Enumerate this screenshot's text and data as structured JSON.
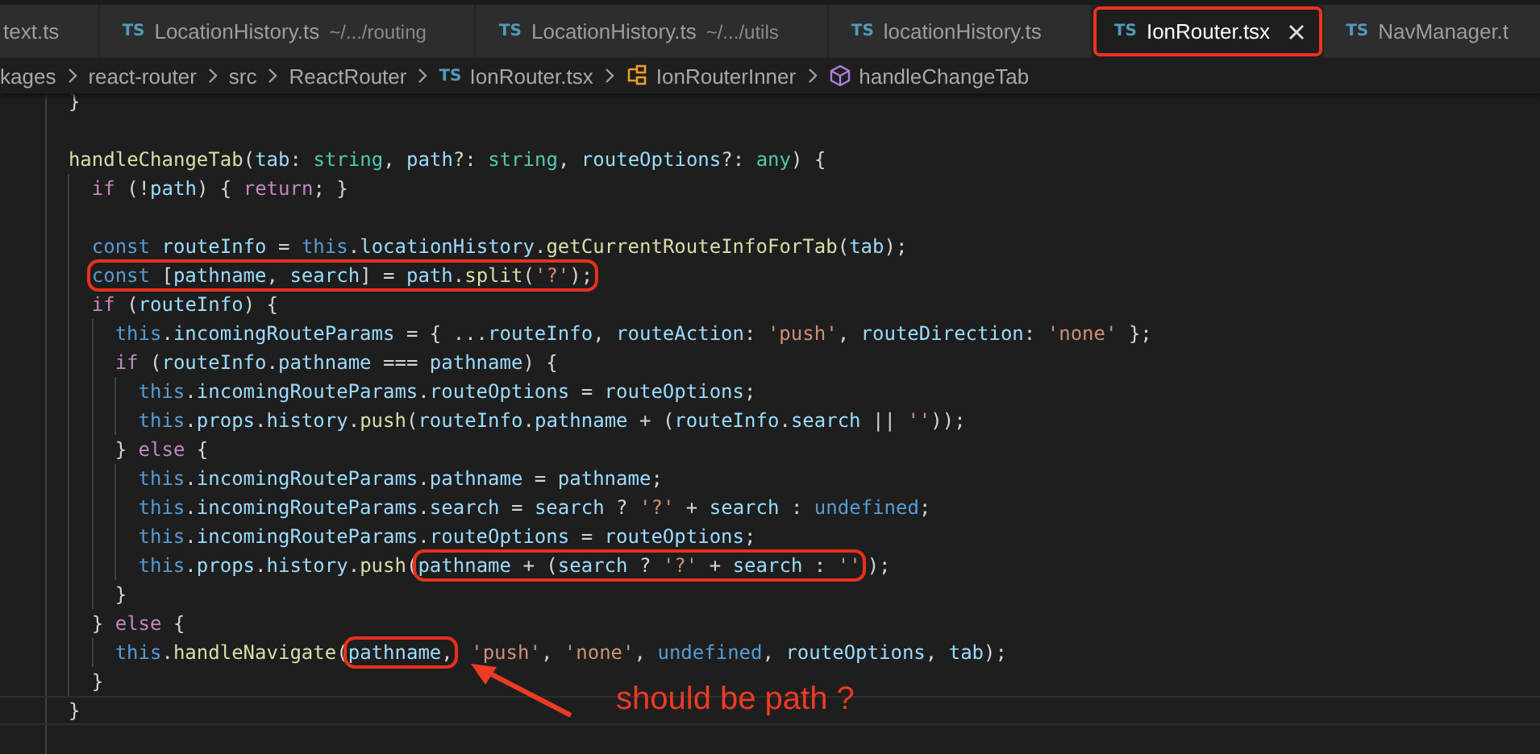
{
  "tabs": [
    {
      "label": "text.ts",
      "selected": false,
      "annotated": false
    },
    {
      "badge": "TS",
      "label": "LocationHistory.ts",
      "description": "~/.../routing",
      "selected": false,
      "annotated": false
    },
    {
      "badge": "TS",
      "label": "LocationHistory.ts",
      "description": "~/.../utils",
      "selected": false,
      "annotated": false
    },
    {
      "badge": "TS",
      "label": "locationHistory.ts",
      "selected": false,
      "annotated": false
    },
    {
      "badge": "TS",
      "label": "IonRouter.tsx",
      "selected": true,
      "annotated": true
    },
    {
      "badge": "TS",
      "label": "NavManager.t",
      "selected": false,
      "annotated": false
    }
  ],
  "breadcrumb": [
    {
      "kind": "folder",
      "label": "kages"
    },
    {
      "kind": "folder",
      "label": "react-router"
    },
    {
      "kind": "folder",
      "label": "src"
    },
    {
      "kind": "folder",
      "label": "ReactRouter"
    },
    {
      "kind": "file",
      "badge": "TS",
      "label": "IonRouter.tsx"
    },
    {
      "kind": "class",
      "label": "IonRouterInner"
    },
    {
      "kind": "method",
      "label": "handleChangeTab"
    }
  ],
  "code": [
    {
      "kind": "code",
      "current": false,
      "tokens": [
        {
          "text": "  }",
          "kind": "punct"
        }
      ]
    },
    {
      "kind": "blank",
      "current": false
    },
    {
      "kind": "code",
      "current": false,
      "tokens": [
        {
          "text": "  handleChangeTab",
          "kind": "fn"
        },
        {
          "text": "(",
          "kind": "punct"
        },
        {
          "text": "tab",
          "kind": "var"
        },
        {
          "text": ": ",
          "kind": "punct"
        },
        {
          "text": "string",
          "kind": "type"
        },
        {
          "text": ", ",
          "kind": "punct"
        },
        {
          "text": "path",
          "kind": "var"
        },
        {
          "text": "?: ",
          "kind": "punct"
        },
        {
          "text": "string",
          "kind": "type"
        },
        {
          "text": ", ",
          "kind": "punct"
        },
        {
          "text": "routeOptions",
          "kind": "var"
        },
        {
          "text": "?: ",
          "kind": "punct"
        },
        {
          "text": "any",
          "kind": "type"
        },
        {
          "text": ") {",
          "kind": "punct"
        }
      ]
    },
    {
      "kind": "code",
      "current": false,
      "tokens": [
        {
          "text": "    if",
          "kind": "kw"
        },
        {
          "text": " (!",
          "kind": "punct"
        },
        {
          "text": "path",
          "kind": "var"
        },
        {
          "text": ") { ",
          "kind": "punct"
        },
        {
          "text": "return",
          "kind": "kw"
        },
        {
          "text": "; }",
          "kind": "punct"
        }
      ]
    },
    {
      "kind": "blank",
      "current": false
    },
    {
      "kind": "code",
      "current": false,
      "tokens": [
        {
          "text": "    const",
          "kind": "storage"
        },
        {
          "text": " routeInfo",
          "kind": "var"
        },
        {
          "text": " = ",
          "kind": "punct"
        },
        {
          "text": "this",
          "kind": "storage"
        },
        {
          "text": ".",
          "kind": "punct"
        },
        {
          "text": "locationHistory",
          "kind": "var"
        },
        {
          "text": ".",
          "kind": "punct"
        },
        {
          "text": "getCurrentRouteInfoForTab",
          "kind": "fn"
        },
        {
          "text": "(",
          "kind": "punct"
        },
        {
          "text": "tab",
          "kind": "var"
        },
        {
          "text": ");",
          "kind": "punct"
        }
      ]
    },
    {
      "kind": "code",
      "current": false,
      "tokens": [
        {
          "kind": "boxed",
          "tokens": [
            {
              "text": "const",
              "kind": "storage"
            },
            {
              "text": " [",
              "kind": "punct"
            },
            {
              "text": "pathname",
              "kind": "var"
            },
            {
              "text": ", ",
              "kind": "punct"
            },
            {
              "text": "search",
              "kind": "var"
            },
            {
              "text": "] = ",
              "kind": "punct"
            },
            {
              "text": "path",
              "kind": "var"
            },
            {
              "text": ".",
              "kind": "punct"
            },
            {
              "text": "split",
              "kind": "fn"
            },
            {
              "text": "(",
              "kind": "punct"
            },
            {
              "text": "'?'",
              "kind": "str"
            },
            {
              "text": ");",
              "kind": "punct"
            }
          ]
        }
      ]
    },
    {
      "kind": "code",
      "current": false,
      "tokens": [
        {
          "text": "    if",
          "kind": "kw"
        },
        {
          "text": " (",
          "kind": "punct"
        },
        {
          "text": "routeInfo",
          "kind": "var"
        },
        {
          "text": ") {",
          "kind": "punct"
        }
      ]
    },
    {
      "kind": "code",
      "current": false,
      "tokens": [
        {
          "text": "      this",
          "kind": "storage"
        },
        {
          "text": ".",
          "kind": "punct"
        },
        {
          "text": "incomingRouteParams",
          "kind": "var"
        },
        {
          "text": " = { ...",
          "kind": "punct"
        },
        {
          "text": "routeInfo",
          "kind": "var"
        },
        {
          "text": ", ",
          "kind": "punct"
        },
        {
          "text": "routeAction",
          "kind": "var"
        },
        {
          "text": ": ",
          "kind": "punct"
        },
        {
          "text": "'push'",
          "kind": "str"
        },
        {
          "text": ", ",
          "kind": "punct"
        },
        {
          "text": "routeDirection",
          "kind": "var"
        },
        {
          "text": ": ",
          "kind": "punct"
        },
        {
          "text": "'none'",
          "kind": "str"
        },
        {
          "text": " };",
          "kind": "punct"
        }
      ]
    },
    {
      "kind": "code",
      "current": false,
      "tokens": [
        {
          "text": "      if",
          "kind": "kw"
        },
        {
          "text": " (",
          "kind": "punct"
        },
        {
          "text": "routeInfo",
          "kind": "var"
        },
        {
          "text": ".",
          "kind": "punct"
        },
        {
          "text": "pathname",
          "kind": "var"
        },
        {
          "text": " === ",
          "kind": "punct"
        },
        {
          "text": "pathname",
          "kind": "var"
        },
        {
          "text": ") {",
          "kind": "punct"
        }
      ]
    },
    {
      "kind": "code",
      "current": false,
      "tokens": [
        {
          "text": "        this",
          "kind": "storage"
        },
        {
          "text": ".",
          "kind": "punct"
        },
        {
          "text": "incomingRouteParams",
          "kind": "var"
        },
        {
          "text": ".",
          "kind": "punct"
        },
        {
          "text": "routeOptions",
          "kind": "var"
        },
        {
          "text": " = ",
          "kind": "punct"
        },
        {
          "text": "routeOptions",
          "kind": "var"
        },
        {
          "text": ";",
          "kind": "punct"
        }
      ]
    },
    {
      "kind": "code",
      "current": false,
      "tokens": [
        {
          "text": "        this",
          "kind": "storage"
        },
        {
          "text": ".",
          "kind": "punct"
        },
        {
          "text": "props",
          "kind": "var"
        },
        {
          "text": ".",
          "kind": "punct"
        },
        {
          "text": "history",
          "kind": "var"
        },
        {
          "text": ".",
          "kind": "punct"
        },
        {
          "text": "push",
          "kind": "fn"
        },
        {
          "text": "(",
          "kind": "punct"
        },
        {
          "text": "routeInfo",
          "kind": "var"
        },
        {
          "text": ".",
          "kind": "punct"
        },
        {
          "text": "pathname",
          "kind": "var"
        },
        {
          "text": " + (",
          "kind": "punct"
        },
        {
          "text": "routeInfo",
          "kind": "var"
        },
        {
          "text": ".",
          "kind": "punct"
        },
        {
          "text": "search",
          "kind": "var"
        },
        {
          "text": " || ",
          "kind": "punct"
        },
        {
          "text": "''",
          "kind": "str"
        },
        {
          "text": "));",
          "kind": "punct"
        }
      ]
    },
    {
      "kind": "code",
      "current": false,
      "tokens": [
        {
          "text": "      } ",
          "kind": "punct"
        },
        {
          "text": "else",
          "kind": "kw"
        },
        {
          "text": " {",
          "kind": "punct"
        }
      ]
    },
    {
      "kind": "code",
      "current": false,
      "tokens": [
        {
          "text": "        this",
          "kind": "storage"
        },
        {
          "text": ".",
          "kind": "punct"
        },
        {
          "text": "incomingRouteParams",
          "kind": "var"
        },
        {
          "text": ".",
          "kind": "punct"
        },
        {
          "text": "pathname",
          "kind": "var"
        },
        {
          "text": " = ",
          "kind": "punct"
        },
        {
          "text": "pathname",
          "kind": "var"
        },
        {
          "text": ";",
          "kind": "punct"
        }
      ]
    },
    {
      "kind": "code",
      "current": false,
      "tokens": [
        {
          "text": "        this",
          "kind": "storage"
        },
        {
          "text": ".",
          "kind": "punct"
        },
        {
          "text": "incomingRouteParams",
          "kind": "var"
        },
        {
          "text": ".",
          "kind": "punct"
        },
        {
          "text": "search",
          "kind": "var"
        },
        {
          "text": " = ",
          "kind": "punct"
        },
        {
          "text": "search",
          "kind": "var"
        },
        {
          "text": " ? ",
          "kind": "punct"
        },
        {
          "text": "'?'",
          "kind": "str"
        },
        {
          "text": " + ",
          "kind": "punct"
        },
        {
          "text": "search",
          "kind": "var"
        },
        {
          "text": " : ",
          "kind": "punct"
        },
        {
          "text": "undefined",
          "kind": "storage"
        },
        {
          "text": ";",
          "kind": "punct"
        }
      ]
    },
    {
      "kind": "code",
      "current": false,
      "tokens": [
        {
          "text": "        this",
          "kind": "storage"
        },
        {
          "text": ".",
          "kind": "punct"
        },
        {
          "text": "incomingRouteParams",
          "kind": "var"
        },
        {
          "text": ".",
          "kind": "punct"
        },
        {
          "text": "routeOptions",
          "kind": "var"
        },
        {
          "text": " = ",
          "kind": "punct"
        },
        {
          "text": "routeOptions",
          "kind": "var"
        },
        {
          "text": ";",
          "kind": "punct"
        }
      ]
    },
    {
      "kind": "code",
      "current": false,
      "tokens": [
        {
          "text": "        this",
          "kind": "storage"
        },
        {
          "text": ".",
          "kind": "punct"
        },
        {
          "text": "props",
          "kind": "var"
        },
        {
          "text": ".",
          "kind": "punct"
        },
        {
          "text": "history",
          "kind": "var"
        },
        {
          "text": ".",
          "kind": "punct"
        },
        {
          "text": "push",
          "kind": "fn"
        },
        {
          "text": "(",
          "kind": "punct"
        },
        {
          "kind": "boxed",
          "tokens": [
            {
              "text": "pathname",
              "kind": "var"
            },
            {
              "text": " + (",
              "kind": "punct"
            },
            {
              "text": "search",
              "kind": "var"
            },
            {
              "text": " ? ",
              "kind": "punct"
            },
            {
              "text": "'?'",
              "kind": "str"
            },
            {
              "text": " + ",
              "kind": "punct"
            },
            {
              "text": "search",
              "kind": "var"
            },
            {
              "text": " : ",
              "kind": "punct"
            },
            {
              "text": "''",
              "kind": "str"
            }
          ]
        },
        {
          "text": ");",
          "kind": "punct"
        }
      ]
    },
    {
      "kind": "code",
      "current": false,
      "tokens": [
        {
          "text": "      }",
          "kind": "punct"
        }
      ]
    },
    {
      "kind": "code",
      "current": false,
      "tokens": [
        {
          "text": "    } ",
          "kind": "punct"
        },
        {
          "text": "else",
          "kind": "kw"
        },
        {
          "text": " {",
          "kind": "punct"
        }
      ]
    },
    {
      "kind": "code",
      "current": false,
      "tokens": [
        {
          "text": "      this",
          "kind": "storage"
        },
        {
          "text": ".",
          "kind": "punct"
        },
        {
          "text": "handleNavigate",
          "kind": "fn"
        },
        {
          "text": "(",
          "kind": "punct"
        },
        {
          "kind": "boxed",
          "tokens": [
            {
              "text": "pathname",
              "kind": "var"
            },
            {
              "text": ",",
              "kind": "punct"
            }
          ]
        },
        {
          "text": " 'push'",
          "kind": "str"
        },
        {
          "text": ", ",
          "kind": "punct"
        },
        {
          "text": "'none'",
          "kind": "str"
        },
        {
          "text": ", ",
          "kind": "punct"
        },
        {
          "text": "undefined",
          "kind": "storage"
        },
        {
          "text": ", ",
          "kind": "punct"
        },
        {
          "text": "routeOptions",
          "kind": "var"
        },
        {
          "text": ", ",
          "kind": "punct"
        },
        {
          "text": "tab",
          "kind": "var"
        },
        {
          "text": ");",
          "kind": "punct"
        }
      ]
    },
    {
      "kind": "code",
      "current": false,
      "tokens": [
        {
          "text": "    }",
          "kind": "punct"
        }
      ]
    },
    {
      "kind": "code",
      "current": true,
      "tokens": [
        {
          "text": "  }",
          "kind": "punct"
        }
      ]
    },
    {
      "kind": "blank",
      "current": false
    }
  ],
  "annotation": {
    "text": "should be path ?"
  }
}
